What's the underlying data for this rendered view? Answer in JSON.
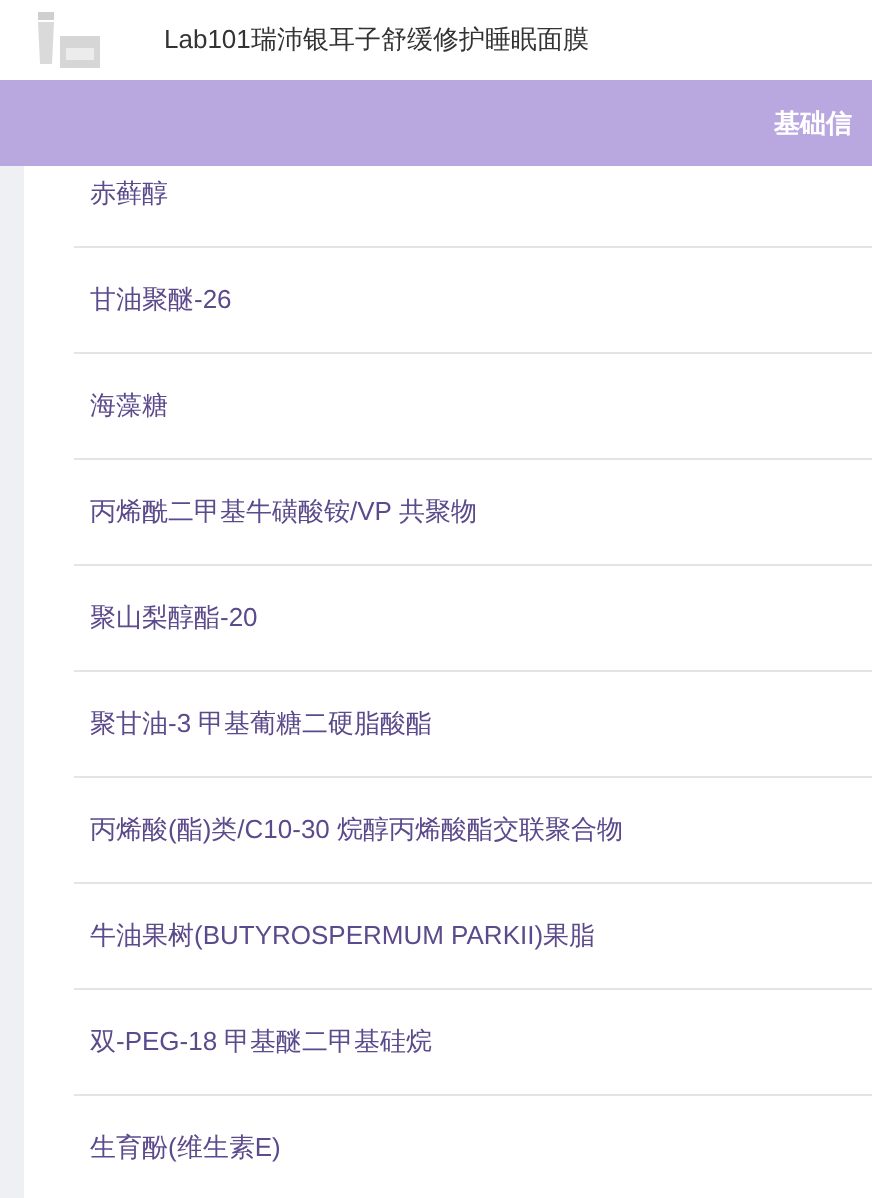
{
  "header": {
    "title": "Lab101瑞沛银耳子舒缓修护睡眠面膜"
  },
  "tab_bar": {
    "label": "基础信"
  },
  "ingredients": [
    {
      "name": "赤藓醇"
    },
    {
      "name": "甘油聚醚-26"
    },
    {
      "name": "海藻糖"
    },
    {
      "name": "丙烯酰二甲基牛磺酸铵/VP 共聚物"
    },
    {
      "name": "聚山梨醇酯-20"
    },
    {
      "name": "聚甘油-3 甲基葡糖二硬脂酸酯"
    },
    {
      "name": "丙烯酸(酯)类/C10-30 烷醇丙烯酸酯交联聚合物"
    },
    {
      "name": "牛油果树(BUTYROSPERMUM PARKII)果脂"
    },
    {
      "name": "双-PEG-18 甲基醚二甲基硅烷"
    },
    {
      "name": "生育酚(维生素E)"
    }
  ]
}
